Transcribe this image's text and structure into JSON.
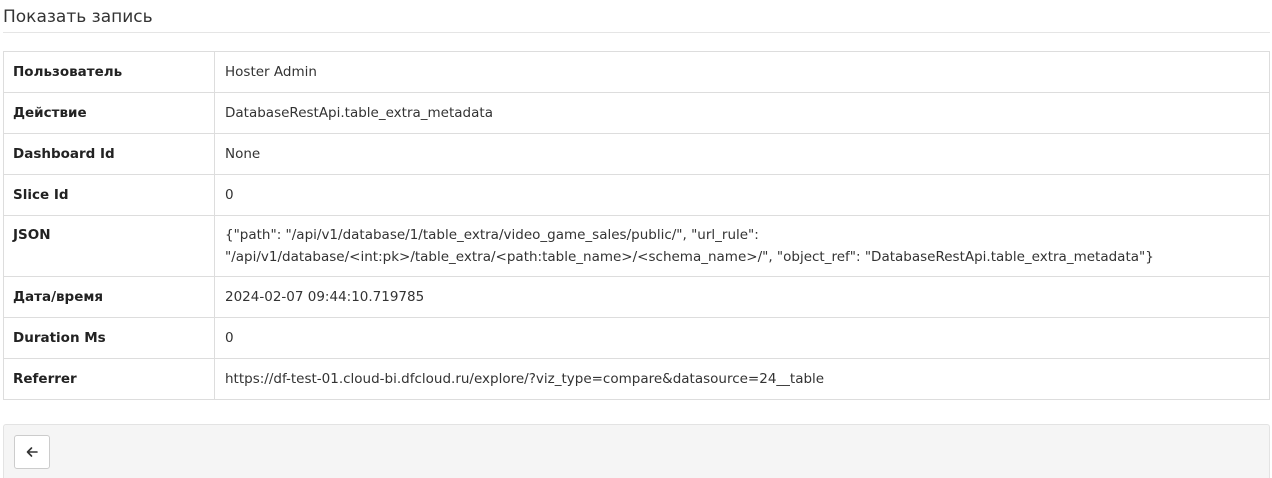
{
  "header": {
    "title": "Показать запись"
  },
  "record": {
    "rows": [
      {
        "key": "Пользователь",
        "value": "Hoster Admin"
      },
      {
        "key": "Действие",
        "value": "DatabaseRestApi.table_extra_metadata"
      },
      {
        "key": "Dashboard Id",
        "value": "None"
      },
      {
        "key": "Slice Id",
        "value": "0"
      },
      {
        "key": "JSON",
        "value": "{\"path\": \"/api/v1/database/1/table_extra/video_game_sales/public/\", \"url_rule\": \"/api/v1/database/<int:pk>/table_extra/<path:table_name>/<schema_name>/\", \"object_ref\": \"DatabaseRestApi.table_extra_metadata\"}"
      },
      {
        "key": "Дата/время",
        "value": "2024-02-07 09:44:10.719785"
      },
      {
        "key": "Duration Ms",
        "value": "0"
      },
      {
        "key": "Referrer",
        "value": "https://df-test-01.cloud-bi.dfcloud.ru/explore/?viz_type=compare&datasource=24__table"
      }
    ]
  },
  "footer": {
    "back_icon": "arrow-left-icon"
  }
}
